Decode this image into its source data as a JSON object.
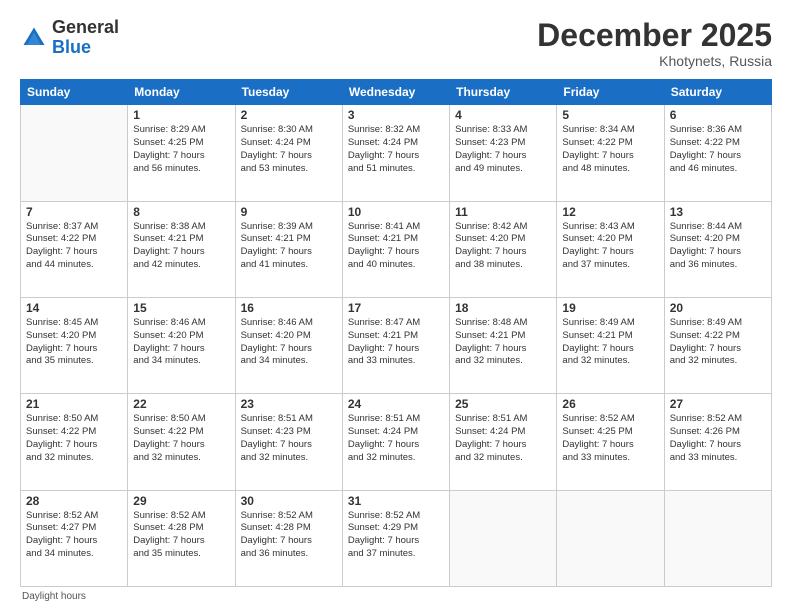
{
  "logo": {
    "general": "General",
    "blue": "Blue"
  },
  "header": {
    "month": "December 2025",
    "location": "Khotynets, Russia"
  },
  "weekdays": [
    "Sunday",
    "Monday",
    "Tuesday",
    "Wednesday",
    "Thursday",
    "Friday",
    "Saturday"
  ],
  "footer": {
    "note": "Daylight hours"
  },
  "weeks": [
    [
      {
        "day": "",
        "info": ""
      },
      {
        "day": "1",
        "info": "Sunrise: 8:29 AM\nSunset: 4:25 PM\nDaylight: 7 hours\nand 56 minutes."
      },
      {
        "day": "2",
        "info": "Sunrise: 8:30 AM\nSunset: 4:24 PM\nDaylight: 7 hours\nand 53 minutes."
      },
      {
        "day": "3",
        "info": "Sunrise: 8:32 AM\nSunset: 4:24 PM\nDaylight: 7 hours\nand 51 minutes."
      },
      {
        "day": "4",
        "info": "Sunrise: 8:33 AM\nSunset: 4:23 PM\nDaylight: 7 hours\nand 49 minutes."
      },
      {
        "day": "5",
        "info": "Sunrise: 8:34 AM\nSunset: 4:22 PM\nDaylight: 7 hours\nand 48 minutes."
      },
      {
        "day": "6",
        "info": "Sunrise: 8:36 AM\nSunset: 4:22 PM\nDaylight: 7 hours\nand 46 minutes."
      }
    ],
    [
      {
        "day": "7",
        "info": "Sunrise: 8:37 AM\nSunset: 4:22 PM\nDaylight: 7 hours\nand 44 minutes."
      },
      {
        "day": "8",
        "info": "Sunrise: 8:38 AM\nSunset: 4:21 PM\nDaylight: 7 hours\nand 42 minutes."
      },
      {
        "day": "9",
        "info": "Sunrise: 8:39 AM\nSunset: 4:21 PM\nDaylight: 7 hours\nand 41 minutes."
      },
      {
        "day": "10",
        "info": "Sunrise: 8:41 AM\nSunset: 4:21 PM\nDaylight: 7 hours\nand 40 minutes."
      },
      {
        "day": "11",
        "info": "Sunrise: 8:42 AM\nSunset: 4:20 PM\nDaylight: 7 hours\nand 38 minutes."
      },
      {
        "day": "12",
        "info": "Sunrise: 8:43 AM\nSunset: 4:20 PM\nDaylight: 7 hours\nand 37 minutes."
      },
      {
        "day": "13",
        "info": "Sunrise: 8:44 AM\nSunset: 4:20 PM\nDaylight: 7 hours\nand 36 minutes."
      }
    ],
    [
      {
        "day": "14",
        "info": "Sunrise: 8:45 AM\nSunset: 4:20 PM\nDaylight: 7 hours\nand 35 minutes."
      },
      {
        "day": "15",
        "info": "Sunrise: 8:46 AM\nSunset: 4:20 PM\nDaylight: 7 hours\nand 34 minutes."
      },
      {
        "day": "16",
        "info": "Sunrise: 8:46 AM\nSunset: 4:20 PM\nDaylight: 7 hours\nand 34 minutes."
      },
      {
        "day": "17",
        "info": "Sunrise: 8:47 AM\nSunset: 4:21 PM\nDaylight: 7 hours\nand 33 minutes."
      },
      {
        "day": "18",
        "info": "Sunrise: 8:48 AM\nSunset: 4:21 PM\nDaylight: 7 hours\nand 32 minutes."
      },
      {
        "day": "19",
        "info": "Sunrise: 8:49 AM\nSunset: 4:21 PM\nDaylight: 7 hours\nand 32 minutes."
      },
      {
        "day": "20",
        "info": "Sunrise: 8:49 AM\nSunset: 4:22 PM\nDaylight: 7 hours\nand 32 minutes."
      }
    ],
    [
      {
        "day": "21",
        "info": "Sunrise: 8:50 AM\nSunset: 4:22 PM\nDaylight: 7 hours\nand 32 minutes."
      },
      {
        "day": "22",
        "info": "Sunrise: 8:50 AM\nSunset: 4:22 PM\nDaylight: 7 hours\nand 32 minutes."
      },
      {
        "day": "23",
        "info": "Sunrise: 8:51 AM\nSunset: 4:23 PM\nDaylight: 7 hours\nand 32 minutes."
      },
      {
        "day": "24",
        "info": "Sunrise: 8:51 AM\nSunset: 4:24 PM\nDaylight: 7 hours\nand 32 minutes."
      },
      {
        "day": "25",
        "info": "Sunrise: 8:51 AM\nSunset: 4:24 PM\nDaylight: 7 hours\nand 32 minutes."
      },
      {
        "day": "26",
        "info": "Sunrise: 8:52 AM\nSunset: 4:25 PM\nDaylight: 7 hours\nand 33 minutes."
      },
      {
        "day": "27",
        "info": "Sunrise: 8:52 AM\nSunset: 4:26 PM\nDaylight: 7 hours\nand 33 minutes."
      }
    ],
    [
      {
        "day": "28",
        "info": "Sunrise: 8:52 AM\nSunset: 4:27 PM\nDaylight: 7 hours\nand 34 minutes."
      },
      {
        "day": "29",
        "info": "Sunrise: 8:52 AM\nSunset: 4:28 PM\nDaylight: 7 hours\nand 35 minutes."
      },
      {
        "day": "30",
        "info": "Sunrise: 8:52 AM\nSunset: 4:28 PM\nDaylight: 7 hours\nand 36 minutes."
      },
      {
        "day": "31",
        "info": "Sunrise: 8:52 AM\nSunset: 4:29 PM\nDaylight: 7 hours\nand 37 minutes."
      },
      {
        "day": "",
        "info": ""
      },
      {
        "day": "",
        "info": ""
      },
      {
        "day": "",
        "info": ""
      }
    ]
  ]
}
